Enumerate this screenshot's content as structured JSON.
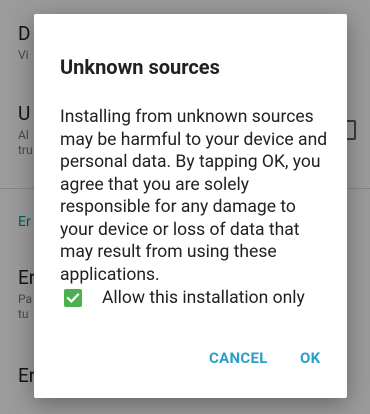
{
  "background": {
    "items": [
      {
        "title": "D",
        "sub": "Vi"
      },
      {
        "title": "U",
        "sub": "Al\ntru"
      },
      {
        "section": "Er"
      },
      {
        "title": "Er",
        "sub": "Pa\ntu"
      },
      {
        "title": "Er",
        "sub": ""
      }
    ]
  },
  "dialog": {
    "title": "Unknown sources",
    "message": "Installing from unknown sources may be harmful to your device and personal data. By tapping OK, you agree that you are solely responsible for any damage to your device or loss of data that may result from using these applications.",
    "checkbox_label": "Allow this installation only",
    "checkbox_checked": true,
    "cancel_label": "CANCEL",
    "ok_label": "OK"
  },
  "colors": {
    "accent": "#26a0c9",
    "checkbox": "#4caf50",
    "section": "#009688"
  }
}
